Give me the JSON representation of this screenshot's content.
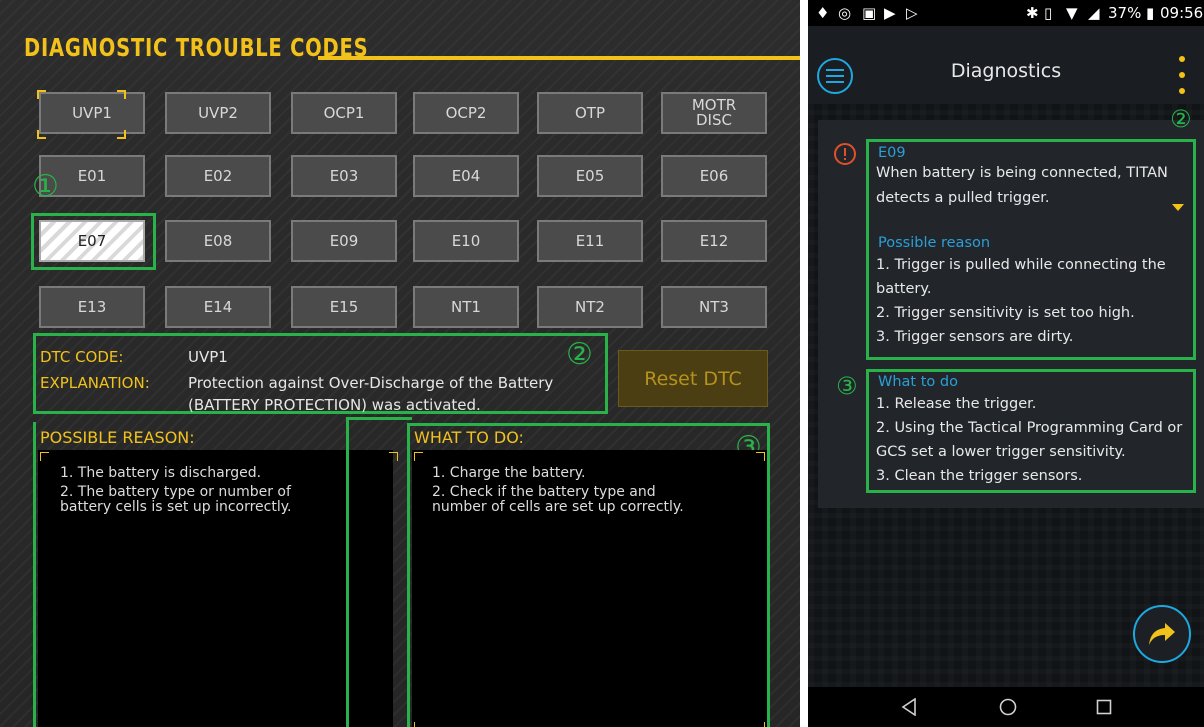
{
  "left": {
    "title": "DIAGNOSTIC TROUBLE CODES",
    "buttons": [
      [
        "UVP1",
        "UVP2",
        "OCP1",
        "OCP2",
        "OTP",
        "MOTR\nDISC"
      ],
      [
        "E01",
        "E02",
        "E03",
        "E04",
        "E05",
        "E06"
      ],
      [
        "E07",
        "E08",
        "E09",
        "E10",
        "E11",
        "E12"
      ],
      [
        "E13",
        "E14",
        "E15",
        "NT1",
        "NT2",
        "NT3"
      ]
    ],
    "selected_code": "E07",
    "markers": {
      "one": "①",
      "two": "②",
      "three": "③"
    },
    "dtc_code_label": "DTC CODE:",
    "dtc_code_value": "UVP1",
    "explanation_label": "EXPLANATION:",
    "explanation_line1": "Protection against Over-Discharge of the Battery",
    "explanation_line2": "(BATTERY PROTECTION) was activated.",
    "reset_label": "Reset DTC",
    "possible_reason_title": "POSSIBLE REASON:",
    "possible_reason_lines": [
      "1. The battery is discharged.",
      "2. The battery type or number of",
      "battery cells is set up incorrectly."
    ],
    "what_to_do_title": "WHAT TO DO:",
    "what_to_do_lines": [
      "1. Charge the battery.",
      "2. Check if the battery type and",
      "number of cells are set up correctly."
    ],
    "accent_color": "#f2c21b",
    "highlight_color": "#29b24a"
  },
  "phone": {
    "status": {
      "battery": "37%",
      "time": "09:56"
    },
    "app_title": "Diagnostics",
    "code": "E09",
    "description_lines": [
      "When battery is being connected, TITAN",
      "detects a pulled trigger."
    ],
    "possible_reason_title": "Possible reason",
    "possible_reason_lines": [
      "1. Trigger is pulled while connecting the",
      "battery.",
      "2. Trigger sensitivity is set too high.",
      "3. Trigger sensors are dirty."
    ],
    "what_to_do_title": "What to do",
    "what_to_do_lines": [
      "1. Release the trigger.",
      "2. Using the Tactical Programming Card or",
      "GCS set a lower trigger sensitivity.",
      "3. Clean the trigger sensors."
    ],
    "markers": {
      "two": "②",
      "three": "③"
    },
    "accent_color": "#1ea8e0",
    "alert_color": "#e0502a"
  }
}
